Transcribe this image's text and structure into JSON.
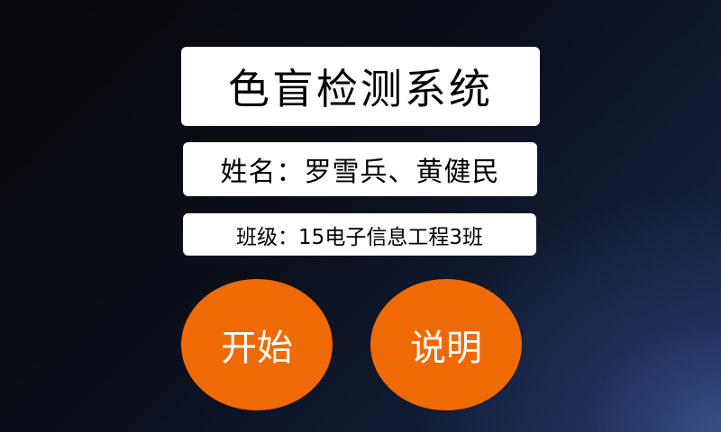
{
  "app": {
    "title": "色盲检测系统"
  },
  "info": {
    "names": "姓名：罗雪兵、黄健民",
    "class": "班级：15电子信息工程3班"
  },
  "buttons": {
    "start_label": "开始",
    "instructions_label": "说明"
  },
  "colors": {
    "accent": "#ef6a04",
    "panel": "#ffffff",
    "background_dark": "#07080b",
    "background_light": "#1c2b52"
  }
}
